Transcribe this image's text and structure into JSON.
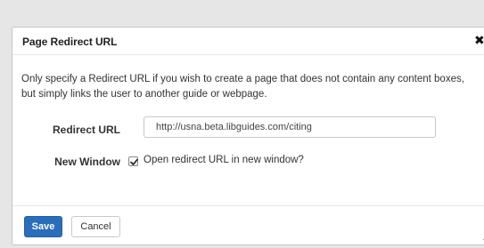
{
  "dialog": {
    "title": "Page Redirect URL",
    "close_glyph": "✖",
    "description": "Only specify a Redirect URL if you wish to create a page that does not contain any content boxes, but simply links the user to another guide or webpage."
  },
  "form": {
    "redirect_url": {
      "label": "Redirect URL",
      "value": "http://usna.beta.libguides.com/citing"
    },
    "new_window": {
      "label": "New Window",
      "checked": true,
      "checkbox_label": "Open redirect URL in new window?"
    }
  },
  "footer": {
    "save_label": "Save",
    "cancel_label": "Cancel"
  },
  "colors": {
    "primary": "#2a6ebb",
    "backdrop": "#e6e6e6"
  },
  "icons": {
    "close": "close-icon",
    "checkbox": "checkmark-icon",
    "resize": "resize-grip-icon"
  }
}
